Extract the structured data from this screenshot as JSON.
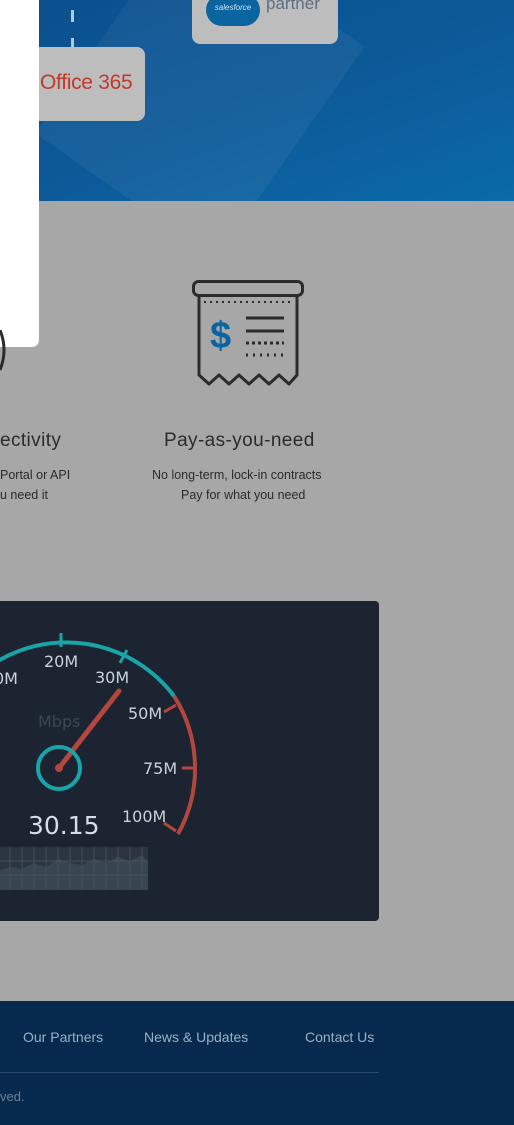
{
  "hero": {
    "salesforce_badge": "salesforce",
    "salesforce_partner": "partner",
    "office365_label": "Office 365"
  },
  "features": [
    {
      "title": "ectivity",
      "lines": [
        "Portal or API",
        "u need it"
      ]
    },
    {
      "title": "Pay-as-you-need",
      "lines": [
        "No long-term, lock-in contracts",
        "Pay for what you need"
      ],
      "icon": "receipt-dollar-icon",
      "accent_color": "#0a64a0"
    }
  ],
  "speedometer": {
    "unit": "Mbps",
    "reading": "30.15",
    "reading_value": 30.15,
    "tick_labels": [
      "0M",
      "20M",
      "30M",
      "50M",
      "75M",
      "100M"
    ],
    "gauge_color": "#1aa3a8",
    "needle_color": "#c0392b"
  },
  "footer": {
    "links": [
      "Our Partners",
      "News & Updates",
      "Contact Us"
    ],
    "copyright": "ved."
  }
}
